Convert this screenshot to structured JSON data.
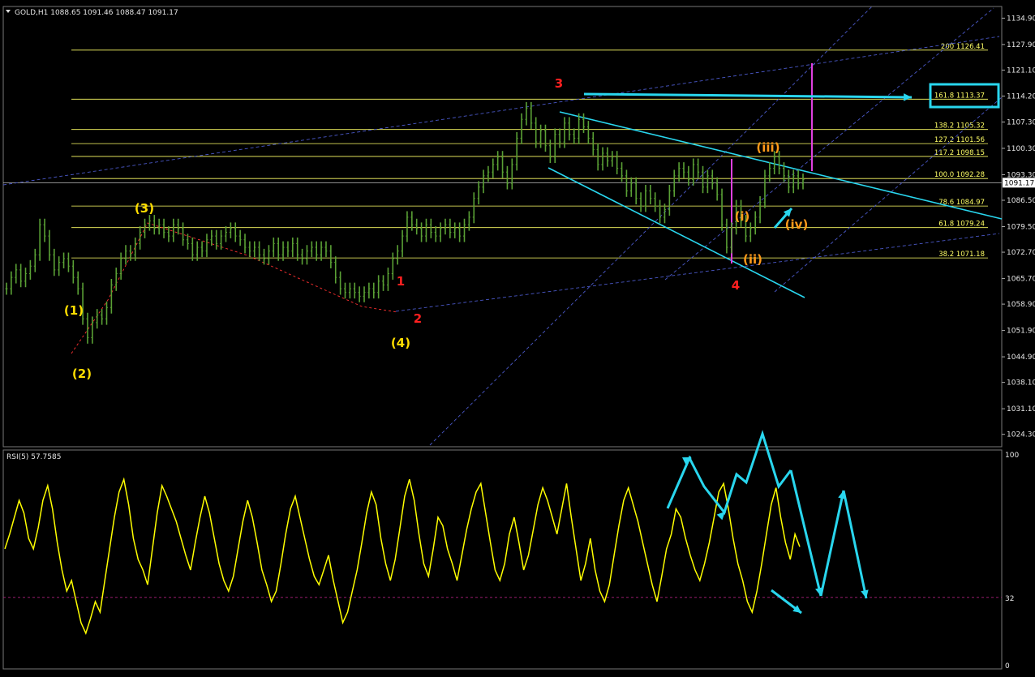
{
  "header": {
    "symbol_info": "GOLD,H1  1088.65 1091.46 1088.47 1091.17"
  },
  "rsi_panel": {
    "label": "RSI(5) 57.7585"
  },
  "colors": {
    "background": "#000000",
    "candles": "#5aa035",
    "fib_lines": "#ffff66",
    "rsi_line": "#ffff00",
    "projection": "#29d6ee",
    "channel": "#4a58c8",
    "wave_primary": "#ff2020",
    "wave_intermediate": "#ffdd00",
    "wave_minor": "#ff9a1a",
    "magenta": "#e040e0"
  },
  "chart_data": [
    {
      "type": "line",
      "title": "",
      "price_axis": {
        "ylim": [
          1021.0,
          1138.0
        ],
        "ticks": [
          "1134.90",
          "1127.90",
          "1121.10",
          "1114.20",
          "1107.30",
          "1100.30",
          "1093.30",
          "1086.50",
          "1079.50",
          "1072.70",
          "1065.70",
          "1058.90",
          "1051.90",
          "1044.90",
          "1038.10",
          "1031.10",
          "1024.30"
        ],
        "current_price": "1091.17"
      },
      "series": [
        {
          "values": [
            1063,
            1066,
            1068,
            1065,
            1067,
            1069,
            1072,
            1080,
            1077,
            1072,
            1068,
            1070,
            1071,
            1069,
            1066,
            1063,
            1055,
            1050,
            1054,
            1056,
            1055,
            1058,
            1064,
            1067,
            1071,
            1073,
            1072,
            1075,
            1078,
            1080,
            1081,
            1079,
            1080,
            1078,
            1077,
            1080,
            1079,
            1076,
            1075,
            1072,
            1074,
            1073,
            1076,
            1077,
            1075,
            1077,
            1078,
            1079,
            1077,
            1076,
            1074,
            1073,
            1074,
            1072,
            1071,
            1073,
            1075,
            1072,
            1074,
            1073,
            1075,
            1072,
            1071,
            1073,
            1074,
            1072,
            1074,
            1073,
            1070,
            1066,
            1063,
            1062,
            1063,
            1062,
            1061,
            1062,
            1063,
            1062,
            1065,
            1064,
            1067,
            1071,
            1073,
            1077,
            1082,
            1080,
            1079,
            1077,
            1080,
            1078,
            1077,
            1079,
            1080,
            1078,
            1079,
            1077,
            1080,
            1082,
            1087,
            1090,
            1093,
            1094,
            1096,
            1098,
            1094,
            1091,
            1096,
            1103,
            1108,
            1111,
            1107,
            1102,
            1105,
            1101,
            1098,
            1104,
            1102,
            1107,
            1104,
            1103,
            1108,
            1106,
            1103,
            1100,
            1096,
            1099,
            1097,
            1098,
            1095,
            1093,
            1089,
            1091,
            1087,
            1085,
            1089,
            1087,
            1085,
            1082,
            1084,
            1089,
            1093,
            1095,
            1094,
            1092,
            1096,
            1094,
            1090,
            1093,
            1091,
            1088,
            1080,
            1074,
            1079,
            1085,
            1081,
            1077,
            1079,
            1082,
            1086,
            1093,
            1095,
            1098,
            1095,
            1093,
            1090,
            1093,
            1091,
            1092
          ],
          "low": 1049.5,
          "high": 1111.5
        }
      ],
      "fibonacci_levels": [
        {
          "ratio": "200",
          "price": 1126.41,
          "label": "200  1126.41"
        },
        {
          "ratio": "161.8",
          "price": 1113.37,
          "label": "161.8  1113.37"
        },
        {
          "ratio": "138.2",
          "price": 1105.32,
          "label": "138.2  1105.32"
        },
        {
          "ratio": "127.2",
          "price": 1101.56,
          "label": "127.2  1101.56"
        },
        {
          "ratio": "117.2",
          "price": 1098.15,
          "label": "117.2  1098.15"
        },
        {
          "ratio": "100.0",
          "price": 1092.28,
          "label": "100.0   1092.28"
        },
        {
          "ratio": "78.6",
          "price": 1084.97,
          "label": "78.6  1084.97"
        },
        {
          "ratio": "61.8",
          "price": 1079.24,
          "label": "61.8  1079.24"
        },
        {
          "ratio": "38.2",
          "price": 1071.18,
          "label": "38.2  1071.18"
        }
      ],
      "wave_labels": {
        "primary": [
          "1",
          "2",
          "3",
          "4"
        ],
        "intermediate": [
          "(1)",
          "(2)",
          "(3)",
          "(4)"
        ],
        "minor": [
          "(i)",
          "(ii)",
          "(iii)",
          "(iv)"
        ]
      }
    },
    {
      "type": "line",
      "title": "RSI(5) 57.7585",
      "ylim": [
        0,
        100
      ],
      "ticks": [
        "100",
        "32",
        "0"
      ],
      "reference_level": 32,
      "series": [
        {
          "values": [
            55,
            62,
            70,
            78,
            72,
            60,
            55,
            65,
            78,
            85,
            74,
            58,
            45,
            35,
            40,
            30,
            20,
            15,
            22,
            30,
            25,
            40,
            55,
            70,
            82,
            88,
            76,
            60,
            50,
            45,
            38,
            55,
            72,
            85,
            80,
            74,
            68,
            60,
            52,
            45,
            58,
            70,
            80,
            72,
            60,
            48,
            40,
            35,
            42,
            55,
            68,
            78,
            70,
            58,
            45,
            38,
            30,
            35,
            48,
            62,
            74,
            80,
            70,
            60,
            50,
            42,
            38,
            45,
            52,
            40,
            30,
            20,
            25,
            35,
            45,
            58,
            72,
            82,
            76,
            60,
            48,
            40,
            50,
            65,
            80,
            88,
            78,
            62,
            48,
            42,
            55,
            70,
            66,
            55,
            48,
            40,
            52,
            64,
            74,
            82,
            86,
            72,
            58,
            45,
            40,
            48,
            62,
            70,
            58,
            45,
            52,
            64,
            76,
            84,
            78,
            70,
            62,
            74,
            86,
            70,
            55,
            40,
            48,
            60,
            45,
            35,
            30,
            38,
            52,
            66,
            78,
            84,
            76,
            68,
            58,
            48,
            38,
            30,
            42,
            55,
            62,
            74,
            70,
            60,
            52,
            45,
            40,
            48,
            58,
            70,
            82,
            86,
            74,
            60,
            48,
            40,
            30,
            25,
            35,
            48,
            62,
            76,
            84,
            70,
            58,
            50,
            62,
            56
          ],
          "annotations": [
            "up-down zigzag projection arrows"
          ]
        }
      ]
    }
  ]
}
